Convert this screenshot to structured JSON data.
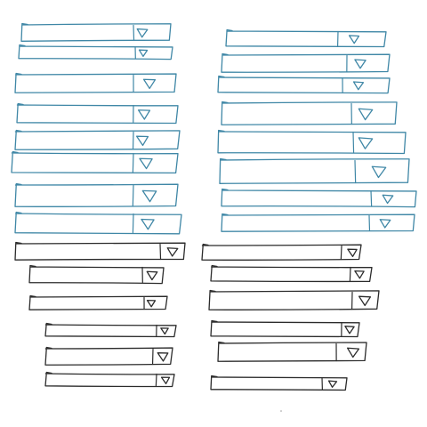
{
  "sketch": {
    "title": "",
    "colors": {
      "blue_ink": "#3f87a6",
      "black_ink": "#2b2b2b",
      "paper": "#ffffff"
    },
    "icon": "triangle-down-icon",
    "blue_dropdowns_count": 16,
    "black_dropdowns_count": 12,
    "dropdown_values": []
  }
}
